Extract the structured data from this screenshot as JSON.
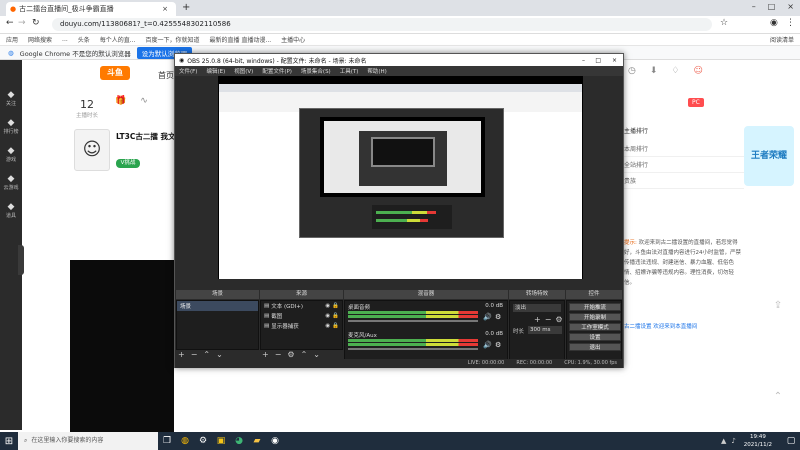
{
  "browser": {
    "tab_title": "古二擂台直播间_极斗争霸直播",
    "url": "douyu.com/11380681?_t=0.4255548302110586",
    "bookmarks": [
      "应用",
      "网络搜索",
      "...",
      "头条",
      "每个人的直...",
      "百度一下，你就知道",
      "最新的直播 直播动漫...",
      "主播中心"
    ],
    "infobar_text": "Google Chrome 不是您的默认浏览器",
    "infobar_button": "设为默认浏览器",
    "read_list": "阅读清单"
  },
  "douyu": {
    "nav_home": "首页",
    "count": "12",
    "count_label": "主播时长",
    "room_title": "LT3C古二擂 我文",
    "follow_btn": "V挑战",
    "sidebar": [
      "关注",
      "排行榜",
      "游戏",
      "云游戏",
      "道具"
    ],
    "notice_label": "提示:",
    "notice_text": "欢迎来到古二擂设置的直播间，若您觉得好，斗鱼由法对直播内容进行24小时监管，严禁传播违法违规、封建迷信、暴力血腥、低俗色情、招嫖诈骗等违规内容。理性消费，切勿轻信。",
    "chat_line": "古二擂设置 欢迎来到本直播间",
    "rank_label": "主播排行",
    "rank_items": [
      "本周排行",
      "全站排行",
      "贵族"
    ],
    "badge_text": "PC",
    "ad_text": "王者荣耀"
  },
  "obs": {
    "title": "OBS 25.0.8 (64-bit, windows) - 配置文件: 未命名 - 场景: 未命名",
    "menu": [
      "文件(F)",
      "编辑(E)",
      "视图(V)",
      "配置文件(P)",
      "场景集合(S)",
      "工具(T)",
      "帮助(H)"
    ],
    "scenes_header": "场景",
    "sources_header": "来源",
    "mixer_header": "混音器",
    "transitions_header": "转场特效",
    "controls_header": "控件",
    "scene_item": "场景",
    "sources": [
      "文本 (GDI+)",
      "截图",
      "显示器捕获"
    ],
    "mixer_tracks": [
      {
        "name": "桌面音频",
        "db": "0.0 dB"
      },
      {
        "name": "麦克风/Aux",
        "db": "0.0 dB"
      }
    ],
    "transition": "淡出",
    "duration_label": "时长",
    "duration": "300 ms",
    "controls": [
      "开始推流",
      "开始录制",
      "工作室模式",
      "设置",
      "退出"
    ],
    "status": {
      "live": "LIVE: 00:00:00",
      "rec": "REC: 00:00:00",
      "cpu": "CPU: 1.9%, 30.00 fps"
    }
  },
  "taskbar": {
    "search_placeholder": "在这里输入你要搜索的内容",
    "time": "19:49",
    "date": "2021/11/2"
  }
}
